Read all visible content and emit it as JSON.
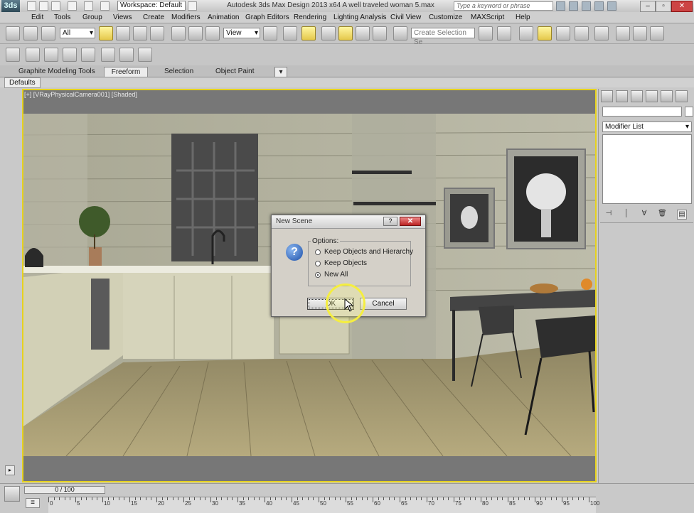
{
  "app": {
    "logo_text": "3ds",
    "workspace": "Workspace: Default",
    "window_title": "Autodesk 3ds Max Design 2013 x64     A well traveled woman 5.max",
    "help_search_placeholder": "Type a keyword or phrase"
  },
  "menu": [
    "Edit",
    "Tools",
    "Group",
    "Views",
    "Create",
    "Modifiers",
    "Animation",
    "Graph Editors",
    "Rendering",
    "Lighting Analysis",
    "Civil View",
    "Customize",
    "MAXScript",
    "Help"
  ],
  "toolbar": {
    "selection_filter": "All",
    "reference_coord": "View",
    "named_selection_placeholder": "Create Selection Se"
  },
  "ribbon": {
    "tabs": [
      "Graphite Modeling Tools",
      "Freeform",
      "Selection",
      "Object Paint"
    ],
    "active_tab": "Freeform",
    "sub_tab": "Defaults"
  },
  "viewport": {
    "label": "[+] [VRayPhysicalCamera001] [Shaded]",
    "border_color": "#e6d21e"
  },
  "command_panel": {
    "modifier_list": "Modifier List",
    "tabs": [
      "create-icon",
      "modify-icon",
      "hierarchy-icon",
      "motion-icon",
      "display-icon",
      "utilities-icon"
    ]
  },
  "dialog": {
    "title": "New Scene",
    "help_label": "?",
    "close_label": "✕",
    "group_label": "Options:",
    "options": [
      {
        "label": "Keep Objects and Hierarchy",
        "selected": false
      },
      {
        "label": "Keep Objects",
        "selected": false
      },
      {
        "label": "New All",
        "selected": true
      }
    ],
    "ok_label": "OK",
    "cancel_label": "Cancel"
  },
  "timeline": {
    "frame_display": "0 / 100",
    "ticks": [
      "0",
      "5",
      "10",
      "15",
      "20",
      "25",
      "30",
      "35",
      "40",
      "45",
      "50",
      "55",
      "60",
      "65",
      "70",
      "75",
      "80",
      "85",
      "90",
      "95",
      "100"
    ]
  }
}
